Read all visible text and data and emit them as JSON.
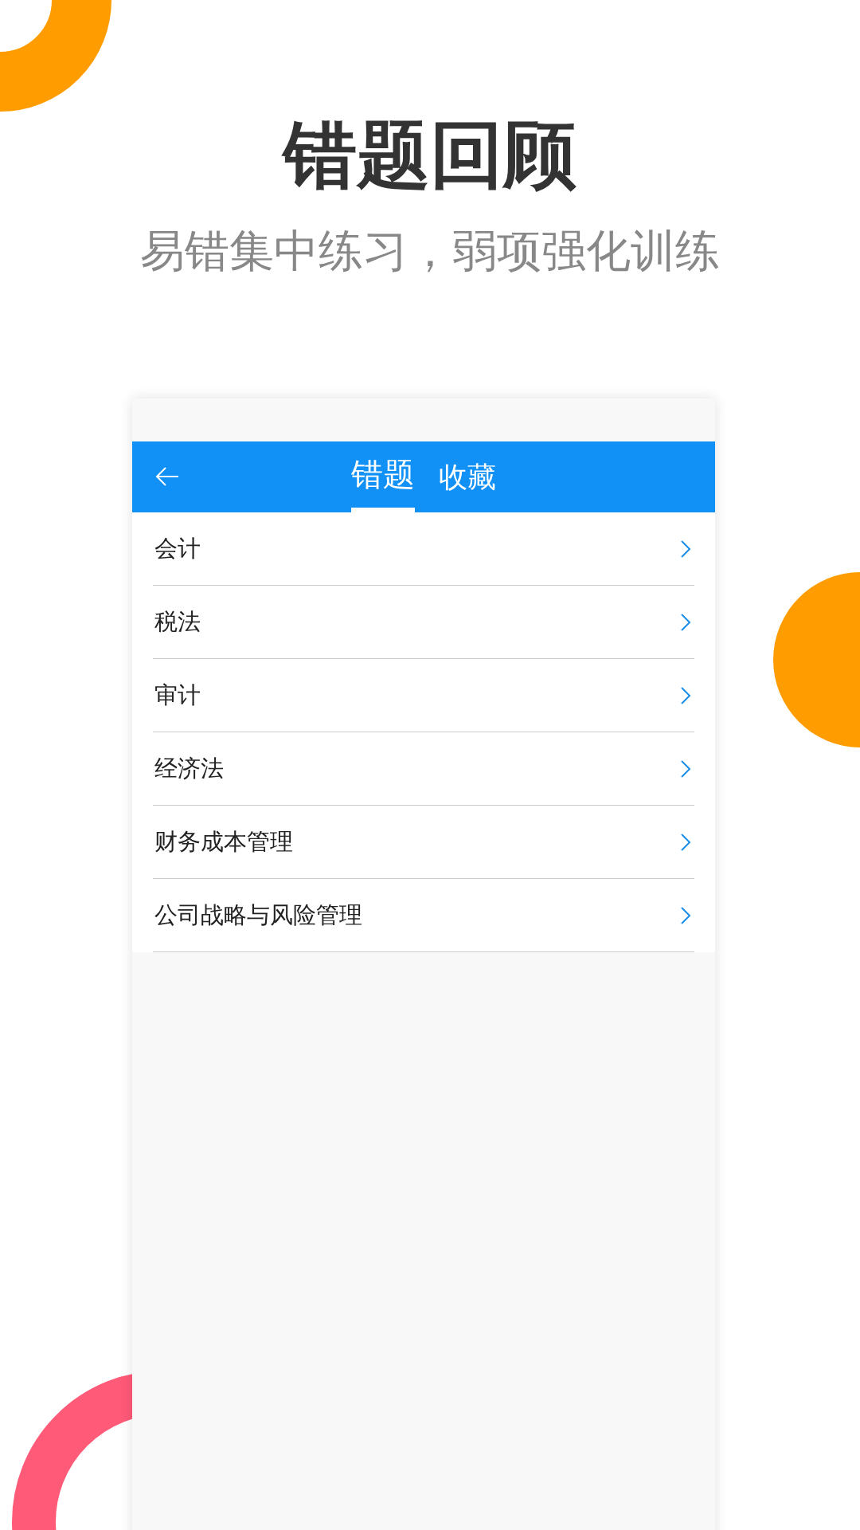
{
  "headline": {
    "title": "错题回顾",
    "subtitle": "易错集中练习，弱项强化训练"
  },
  "phone": {
    "tabs": [
      {
        "label": "错题",
        "selected": true
      },
      {
        "label": "收藏",
        "selected": false
      }
    ],
    "subjects": [
      {
        "label": "会计"
      },
      {
        "label": "税法"
      },
      {
        "label": "审计"
      },
      {
        "label": "经济法"
      },
      {
        "label": "财务成本管理"
      },
      {
        "label": "公司战略与风险管理"
      }
    ]
  }
}
